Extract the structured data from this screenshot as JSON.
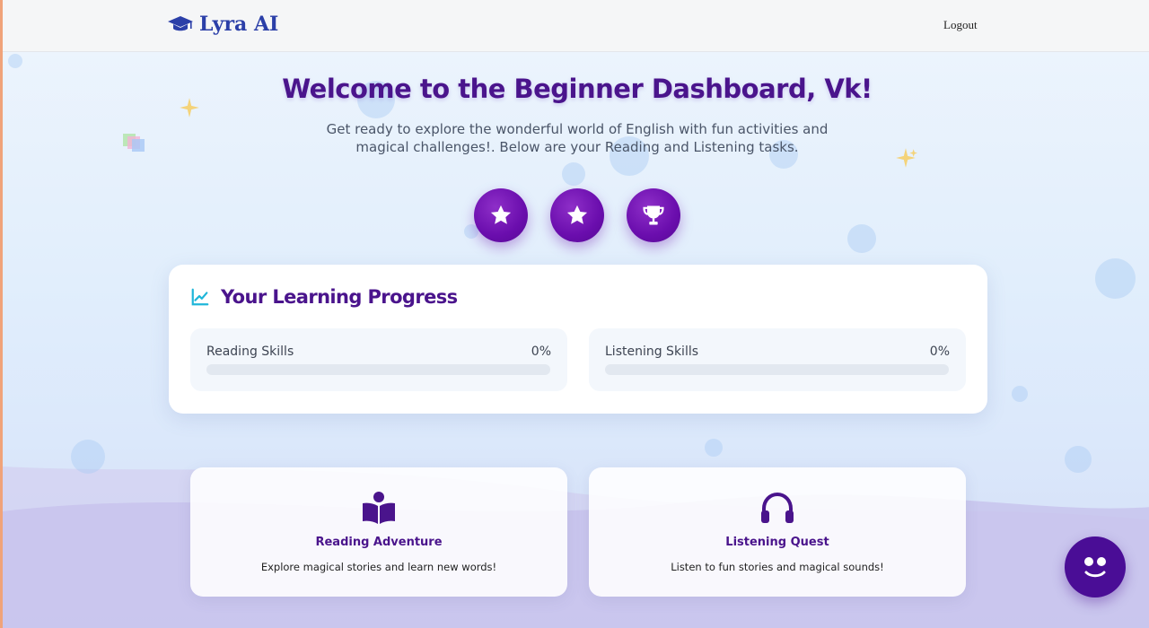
{
  "header": {
    "brand": "Lyra AI",
    "logo_icon": "graduation-cap-icon",
    "logout_label": "Logout"
  },
  "hero": {
    "title": "Welcome to the Beginner Dashboard, Vk!",
    "subtitle": "Get ready to explore the wonderful world of English with fun activities and magical challenges!. Below are your Reading and Listening tasks.",
    "badges": [
      "star-icon",
      "star-icon",
      "trophy-icon"
    ]
  },
  "progress": {
    "title": "Your Learning Progress",
    "icon": "chart-line-icon",
    "skills": [
      {
        "label": "Reading Skills",
        "percent_text": "0%",
        "value": 0
      },
      {
        "label": "Listening Skills",
        "percent_text": "0%",
        "value": 0
      }
    ]
  },
  "activities": [
    {
      "icon": "book-reader-icon",
      "title": "Reading Adventure",
      "description": "Explore magical stories and learn new words!"
    },
    {
      "icon": "headphones-icon",
      "title": "Listening Quest",
      "description": "Listen to fun stories and magical sounds!"
    }
  ],
  "colors": {
    "primary_purple": "#4a148c",
    "badge_purple": "#6a0dad",
    "accent_cyan": "#1fb6d9",
    "brand_blue": "#2b3fa8"
  }
}
